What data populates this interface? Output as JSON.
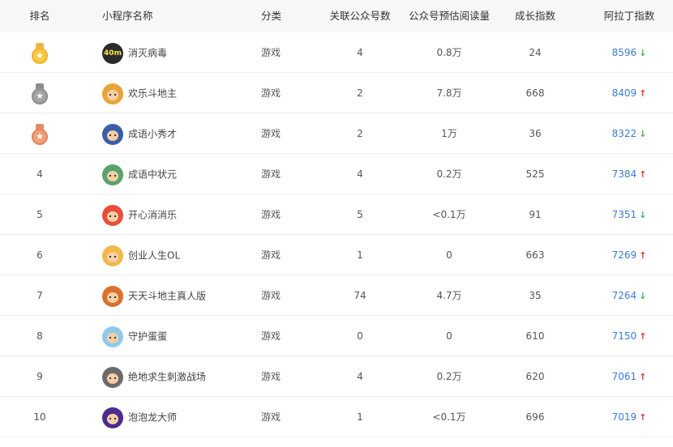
{
  "header": {
    "rank": "排名",
    "name": "小程序名称",
    "category": "分类",
    "accounts": "关联公众号数",
    "reads": "公众号预估阅读量",
    "growth": "成长指数",
    "aladdin": "阿拉丁指数"
  },
  "rows": [
    {
      "rank": "",
      "medal": "gold",
      "name": "消灭病毒",
      "category": "游戏",
      "accounts": "4",
      "reads": "0.8万",
      "growth": "24",
      "aladdin": "8596",
      "trend": "down",
      "avatar_color": "#2b2b2b",
      "avatar_label": "40m"
    },
    {
      "rank": "",
      "medal": "silver",
      "name": "欢乐斗地主",
      "category": "游戏",
      "accounts": "2",
      "reads": "7.8万",
      "growth": "668",
      "aladdin": "8409",
      "trend": "up",
      "avatar_color": "#e8a33b"
    },
    {
      "rank": "",
      "medal": "bronze",
      "name": "成语小秀才",
      "category": "游戏",
      "accounts": "2",
      "reads": "1万",
      "growth": "36",
      "aladdin": "8322",
      "trend": "down",
      "avatar_color": "#3a5ea8"
    },
    {
      "rank": "4",
      "medal": "",
      "name": "成语中状元",
      "category": "游戏",
      "accounts": "4",
      "reads": "0.2万",
      "growth": "525",
      "aladdin": "7384",
      "trend": "up",
      "avatar_color": "#5aa36a"
    },
    {
      "rank": "5",
      "medal": "",
      "name": "开心消消乐",
      "category": "游戏",
      "accounts": "5",
      "reads": "<0.1万",
      "growth": "91",
      "aladdin": "7351",
      "trend": "down",
      "avatar_color": "#e94e3c"
    },
    {
      "rank": "6",
      "medal": "",
      "name": "创业人生OL",
      "category": "游戏",
      "accounts": "1",
      "reads": "0",
      "growth": "663",
      "aladdin": "7269",
      "trend": "up",
      "avatar_color": "#f2b84b"
    },
    {
      "rank": "7",
      "medal": "",
      "name": "天天斗地主真人版",
      "category": "游戏",
      "accounts": "74",
      "reads": "4.7万",
      "growth": "35",
      "aladdin": "7264",
      "trend": "down",
      "avatar_color": "#d9722e"
    },
    {
      "rank": "8",
      "medal": "",
      "name": "守护蛋蛋",
      "category": "游戏",
      "accounts": "0",
      "reads": "0",
      "growth": "610",
      "aladdin": "7150",
      "trend": "up",
      "avatar_color": "#8fcbe8"
    },
    {
      "rank": "9",
      "medal": "",
      "name": "绝地求生刺激战场",
      "category": "游戏",
      "accounts": "4",
      "reads": "0.2万",
      "growth": "620",
      "aladdin": "7061",
      "trend": "up",
      "avatar_color": "#6b6b6b"
    },
    {
      "rank": "10",
      "medal": "",
      "name": "泡泡龙大师",
      "category": "游戏",
      "accounts": "1",
      "reads": "<0.1万",
      "growth": "696",
      "aladdin": "7019",
      "trend": "up",
      "avatar_color": "#4a2d8f"
    }
  ],
  "colors": {
    "aladdin_text": "#3a7bd5",
    "trend_up": "#e53935",
    "trend_down": "#4caf50",
    "header_bg": "#f7f7f7"
  }
}
